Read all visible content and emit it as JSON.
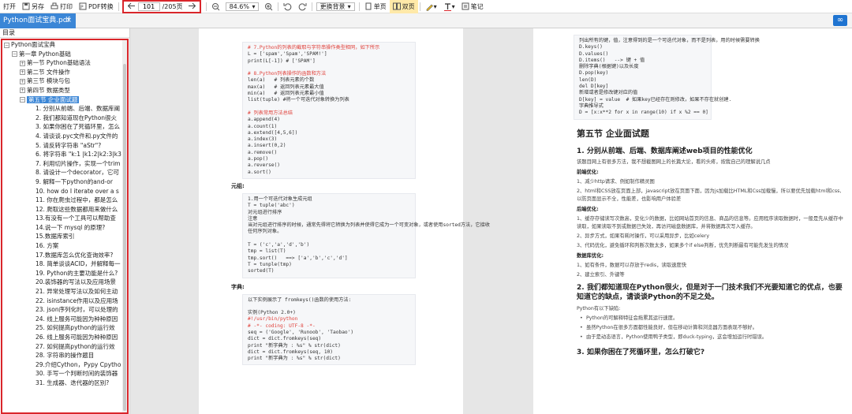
{
  "toolbar": {
    "open": "打开",
    "save_as": "另存",
    "print": "打印",
    "pdf_convert": "PDF转换",
    "current_page": "101",
    "total_pages": "/205页",
    "zoom": "84.6%",
    "background": "更换背景",
    "single": "单页",
    "double": "双页",
    "notes": "笔记"
  },
  "tab": {
    "title": "Python面试宝典.pdf",
    "close": "×"
  },
  "sidebar": {
    "title": "目录",
    "tree": [
      {
        "text": "Python面试宝典",
        "indent": 0,
        "toggle": "−"
      },
      {
        "text": "第一章 Python基础",
        "indent": 1,
        "toggle": "−"
      },
      {
        "text": "第一节 Python基础语法",
        "indent": 2,
        "toggle": "+"
      },
      {
        "text": "第二节 文件操作",
        "indent": 2,
        "toggle": "+"
      },
      {
        "text": "第三节 模块与包",
        "indent": 2,
        "toggle": "+"
      },
      {
        "text": "第四节 数据类型",
        "indent": 2,
        "toggle": "+"
      },
      {
        "text": "第五节 企业面试题",
        "indent": 2,
        "toggle": "−",
        "selected": true
      },
      {
        "text": "1. 分别从前端、后端、数据库阐",
        "indent": 3
      },
      {
        "text": "2. 我们都知道现在Python很火",
        "indent": 3
      },
      {
        "text": "3. 如果你困在了死循环里，怎么",
        "indent": 3
      },
      {
        "text": "4. 请谈谈.pyc文件和.py文件的",
        "indent": 3
      },
      {
        "text": "5. 请反转字符串 \"aStr\"?",
        "indent": 3
      },
      {
        "text": "6. 将字符串 \"k:1 |k1:2|k2:3|k3",
        "indent": 3
      },
      {
        "text": "7. 利用切片操作，实现一个trim",
        "indent": 3
      },
      {
        "text": "8. 请设计一个decorator，它可",
        "indent": 3
      },
      {
        "text": "9. 解释一下python的and-or",
        "indent": 3
      },
      {
        "text": "10. how do I iterate over a s",
        "indent": 3
      },
      {
        "text": "11. 你在爬虫过程中，都是怎么",
        "indent": 3
      },
      {
        "text": "12. 爬取这些数据都用来做什么",
        "indent": 3
      },
      {
        "text": "13.有没有一个工具可以帮助查",
        "indent": 3
      },
      {
        "text": "14.说一下 mysql 的原理?",
        "indent": 3
      },
      {
        "text": "15.数据库索引",
        "indent": 3
      },
      {
        "text": "16. 方案",
        "indent": 3
      },
      {
        "text": "17.数据库怎么优化查询效率?",
        "indent": 3
      },
      {
        "text": "18. 简单谈谈ACID，并解释每一",
        "indent": 3
      },
      {
        "text": "19. Python的主要功能是什么?",
        "indent": 3
      },
      {
        "text": "20.装饰器的写法以及应用场景",
        "indent": 3
      },
      {
        "text": "21. 异常处理写法以及如何主动",
        "indent": 3
      },
      {
        "text": "22. isinstance作用以及应用场",
        "indent": 3
      },
      {
        "text": "23. json序列化时，可以处理的",
        "indent": 3
      },
      {
        "text": "24. 线上服务可能因为种种原因",
        "indent": 3
      },
      {
        "text": "25. 如何提高python的运行效",
        "indent": 3
      },
      {
        "text": "26. 线上服务可能因为种种原因",
        "indent": 3
      },
      {
        "text": "27. 如何提高python的运行效",
        "indent": 3
      },
      {
        "text": "28. 字符串的操作题目",
        "indent": 3
      },
      {
        "text": "29.介绍Cython，Pypy Cpytho",
        "indent": 3
      },
      {
        "text": "30. 手写一个判断时间的装饰器",
        "indent": 3
      },
      {
        "text": "31. 生成器、迭代器的区别?",
        "indent": 3
      }
    ]
  },
  "page_left": {
    "code1": [
      {
        "t": "# 7.Python的列表的截取与字符串操作类型相同，如下所示",
        "c": "red"
      },
      {
        "t": "L = ['spam','Spam','SPAM!']",
        "c": ""
      },
      {
        "t": "print(L[-1]) # ['SPAM']",
        "c": ""
      },
      {
        "t": "",
        "c": ""
      },
      {
        "t": "# 8.Python列表操作的函数和方法",
        "c": "red"
      },
      {
        "t": "len(a)   # 列表元素的个数",
        "c": ""
      },
      {
        "t": "max(a)   # 返回列表元素最大值",
        "c": ""
      },
      {
        "t": "min(a)   # 返回列表元素最小值",
        "c": ""
      },
      {
        "t": "list(tuple) #将一个可迭代对象转换为列表",
        "c": ""
      },
      {
        "t": "",
        "c": ""
      },
      {
        "t": "# 列表常用方法总结",
        "c": "red"
      },
      {
        "t": "a.append(4)",
        "c": ""
      },
      {
        "t": "a.count(1)",
        "c": ""
      },
      {
        "t": "a.extend([4,5,6])",
        "c": ""
      },
      {
        "t": "a.index(3)",
        "c": ""
      },
      {
        "t": "a.insert(0,2)",
        "c": ""
      },
      {
        "t": "a.remove()",
        "c": ""
      },
      {
        "t": "a.pop()",
        "c": ""
      },
      {
        "t": "a.reverse()",
        "c": ""
      },
      {
        "t": "a.sort()",
        "c": ""
      }
    ],
    "label_tuple": "元组:",
    "code2": [
      {
        "t": "1.用一个可迭代对象生成元组",
        "c": ""
      },
      {
        "t": "T = tuple('abc')",
        "c": ""
      },
      {
        "t": "对元组进行排序",
        "c": ""
      },
      {
        "t": "注意",
        "c": ""
      },
      {
        "t": "当对元组进行排序的时候，通常先得将它转换为列表并使得它成为一个可变对象，或者使用sorted方法，它接收",
        "c": ""
      },
      {
        "t": "任何序列对象。",
        "c": ""
      },
      {
        "t": "",
        "c": ""
      },
      {
        "t": "T = ('c','a','d','b')",
        "c": ""
      },
      {
        "t": "tmp = list(T)",
        "c": ""
      },
      {
        "t": "tmp.sort()   ==> ['a','b','c','d']",
        "c": ""
      },
      {
        "t": "T = tunple(tmp)",
        "c": ""
      },
      {
        "t": "sorted(T)",
        "c": ""
      }
    ],
    "label_dict": "字典:",
    "code3": [
      {
        "t": "以下实例展示了 fromkeys()函数的使用方法:",
        "c": ""
      },
      {
        "t": "",
        "c": ""
      },
      {
        "t": "实例(Python 2.0+)",
        "c": ""
      },
      {
        "t": "#!/usr/bin/python",
        "c": "red"
      },
      {
        "t": "# -*- coding: UTF-8 -*-",
        "c": "red"
      },
      {
        "t": "seq = ('Google', 'Runoob', 'Taobao')",
        "c": ""
      },
      {
        "t": "dict = dict.fromkeys(seq)",
        "c": ""
      },
      {
        "t": "print \"新字典为 : %s\" % str(dict)",
        "c": ""
      },
      {
        "t": "dict = dict.fromkeys(seq, 10)",
        "c": ""
      },
      {
        "t": "print \"新字典为 : %s\" % str(dict)",
        "c": ""
      }
    ]
  },
  "page_right": {
    "code1": [
      {
        "t": "列出所有的键，值，注意得到的是一个可迭代对象，而不是列表，用的时候需要转换",
        "c": ""
      },
      {
        "t": "D.keys()",
        "c": ""
      },
      {
        "t": "D.values()",
        "c": ""
      },
      {
        "t": "D.items()   --> 键 + 值",
        "c": ""
      },
      {
        "t": "删除字典(根据键)以及长度",
        "c": ""
      },
      {
        "t": "D.pop(key)",
        "c": ""
      },
      {
        "t": "len(D)",
        "c": ""
      },
      {
        "t": "del D[key]",
        "c": ""
      },
      {
        "t": "新增或者是修改键对应的值",
        "c": ""
      },
      {
        "t": "D[key] = value  # 如果key已经存在则修改，如果不存在就创建.",
        "c": ""
      },
      {
        "t": "字典推导式",
        "c": ""
      },
      {
        "t": "D = [x:x**2 for x in range(10) if x %2 == 0]",
        "c": ""
      }
    ],
    "section_title": "第五节 企业面试题",
    "q1_title": "1. 分别从前端、后端、数据库阐述web项目的性能优化",
    "q1_intro": "该题目网上有很多方法，我不想截图网上的长篇大论，看的头疼，按我自己的理解说几点",
    "front_label": "前端优化:",
    "front_items": [
      "1、减少http请求、例如制作精灵图",
      "2、html和CSS放在页面上部，javascript放在页面下面，因为js加载比HTML和Css加载慢，所以要优先加载html和css,以防页面显示不全，性能差，也影响用户体验差"
    ],
    "back_label": "后端优化:",
    "back_items": [
      "1、缓存存储读写次数高，变化少的数据，比如网站首页的信息、商品的信息等。应用程序读取数据时，一般是先从缓存中读取，如果读取不到或数据已失效，再访问磁盘数据库，并将数据再次写入缓存。",
      "2、异步方式，如果有耗时操作，可以采用异步，比如celery",
      "3、代码优化，避免循环和判断次数太多，如果多个if else判断，优先判断最有可能先发生的情况"
    ],
    "db_label": "数据库优化:",
    "db_items": [
      "1、如有条件，数据可以存放于redis，读取速度快",
      "2、建立索引、外键等"
    ],
    "q2_title": "2. 我们都知道现在Python很火，但是对于一门技术我们不光要知道它的优点，也要知道它的缺点，请谈谈Python的不足之处。",
    "q2_intro": "Python有以下缺陷:",
    "q2_bullets": [
      "Python的可解释特征会拖累其运行速度。",
      "虽然Python在很多方面都性能良好，但在移动计算和浏览器方面表现不够好。",
      "由于是动态语言，Python使用鸭子类型，即duck-typing，这会增加运行时错误。"
    ],
    "q3_title": "3. 如果你困在了死循环里，怎么打破它?"
  },
  "colors": {
    "accent": "#3b86d6",
    "highlight": "#d9262b"
  }
}
